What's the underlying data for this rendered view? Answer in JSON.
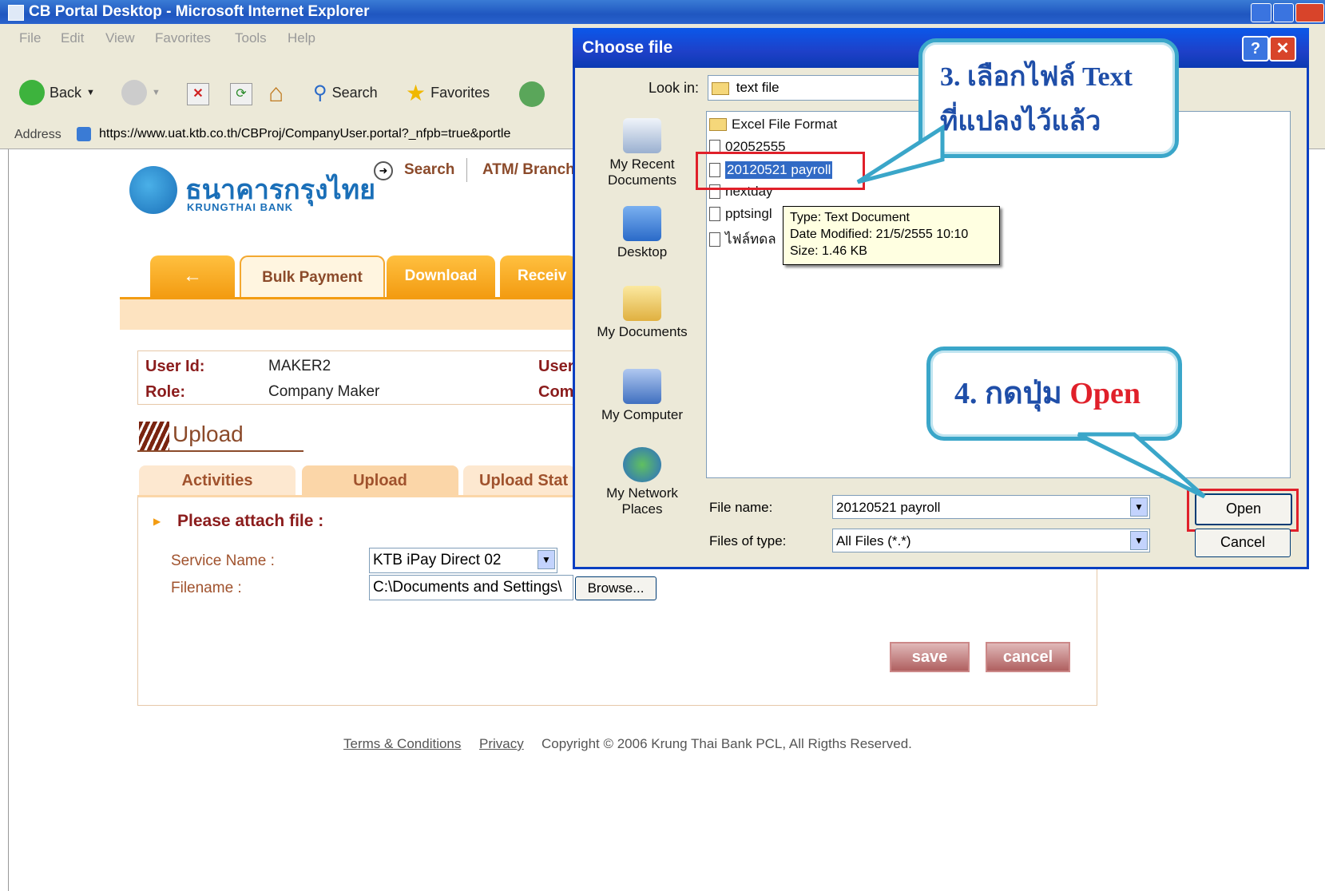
{
  "window": {
    "title": "CB Portal Desktop - Microsoft Internet Explorer"
  },
  "menu": [
    "File",
    "Edit",
    "View",
    "Favorites",
    "Tools",
    "Help"
  ],
  "toolbar": {
    "back": "Back",
    "search": "Search",
    "favorites": "Favorites"
  },
  "address": {
    "label": "Address",
    "url": "https://www.uat.ktb.co.th/CBProj/CompanyUser.portal?_nfpb=true&portle"
  },
  "bank": {
    "name_th": "ธนาคารกรุงไทย",
    "name_en": "KRUNGTHAI BANK"
  },
  "topnav": {
    "search": "Search",
    "atm": "ATM/ Branch"
  },
  "main_tabs": [
    {
      "label": "←"
    },
    {
      "label": "Bulk Payment"
    },
    {
      "label": "Download"
    },
    {
      "label": "Receiv"
    }
  ],
  "user_info": {
    "user_id_label": "User Id:",
    "user_id": "MAKER2",
    "role_label": "Role:",
    "role": "Company Maker",
    "user_right_label": "User",
    "company_right_label": "Com"
  },
  "section_title": "Upload",
  "sub_tabs": [
    {
      "label": "Activities"
    },
    {
      "label": "Upload"
    },
    {
      "label": "Upload Stat"
    }
  ],
  "form": {
    "attach_label": "Please attach file :",
    "service_label": "Service Name :",
    "service_value": "KTB iPay Direct 02",
    "filename_label": "Filename :",
    "filename_value": "C:\\Documents and Settings\\",
    "browse": "Browse...",
    "save": "save",
    "cancel": "cancel"
  },
  "footer": {
    "terms": "Terms & Conditions",
    "privacy": "Privacy",
    "copyright": "Copyright © 2006 Krung Thai Bank PCL, All Rigths Reserved."
  },
  "dialog": {
    "title": "Choose file",
    "look_in_label": "Look in:",
    "look_in_value": "text file",
    "places": [
      {
        "label": "My Recent Documents",
        "icon": "recent-documents-icon"
      },
      {
        "label": "Desktop",
        "icon": "desktop-icon"
      },
      {
        "label": "My Documents",
        "icon": "my-documents-icon"
      },
      {
        "label": "My Computer",
        "icon": "my-computer-icon"
      },
      {
        "label": "My Network Places",
        "icon": "network-places-icon"
      }
    ],
    "files": [
      "Excel File Format",
      "02052555",
      "20120521 payroll",
      "nextday",
      "pptsingl",
      "ไฟล์ทดล"
    ],
    "tooltip": {
      "type": "Type: Text Document",
      "date": "Date Modified: 21/5/2555 10:10",
      "size": "Size: 1.46 KB"
    },
    "file_name_label": "File name:",
    "file_name_value": "20120521 payroll",
    "file_type_label": "Files of type:",
    "file_type_value": "All Files (*.*)",
    "open": "Open",
    "cancel": "Cancel"
  },
  "callouts": {
    "step3_line1": "3. เลือกไฟล์ Text",
    "step3_line2": "ที่แปลงไว้แล้ว",
    "step4_prefix": "4. กดปุ่ม ",
    "step4_open": "Open"
  },
  "colors": {
    "accent_orange": "#f39c12",
    "callout_border": "#3aa6c9",
    "highlight_red": "#e0202a",
    "dialog_blue": "#0b58ea"
  }
}
